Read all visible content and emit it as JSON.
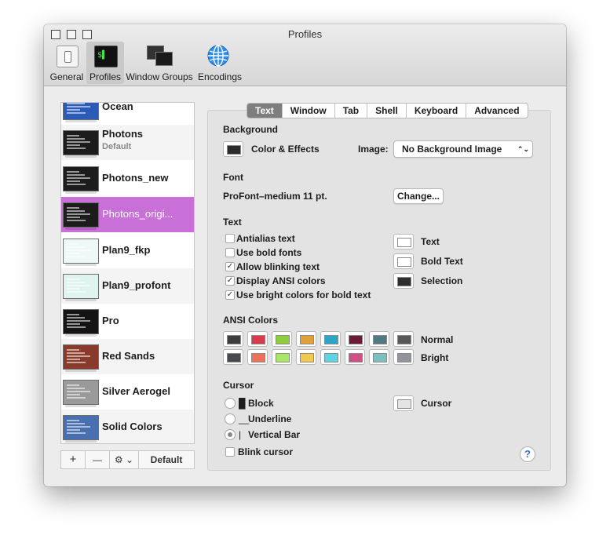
{
  "window": {
    "title": "Profiles"
  },
  "toolbar": {
    "items": [
      {
        "label": "General",
        "icon": "switch-icon"
      },
      {
        "label": "Profiles",
        "icon": "terminal-icon"
      },
      {
        "label": "Window Groups",
        "icon": "window-groups-icon"
      },
      {
        "label": "Encodings",
        "icon": "globe-icon"
      }
    ]
  },
  "profiles": {
    "items": [
      {
        "name": "Ocean",
        "subtitle": "",
        "thumb_color": "#2a5bb8"
      },
      {
        "name": "Photons",
        "subtitle": "Default",
        "thumb_color": "#1c1c1c"
      },
      {
        "name": "Photons_new",
        "subtitle": "",
        "thumb_color": "#1c1c1c"
      },
      {
        "name": "Photons_origi...",
        "subtitle": "",
        "thumb_color": "#1c1c1c"
      },
      {
        "name": "Plan9_fkp",
        "subtitle": "",
        "thumb_color": "#eef8f6"
      },
      {
        "name": "Plan9_profont",
        "subtitle": "",
        "thumb_color": "#dff4ee"
      },
      {
        "name": "Pro",
        "subtitle": "",
        "thumb_color": "#141414"
      },
      {
        "name": "Red Sands",
        "subtitle": "",
        "thumb_color": "#8a3a2a"
      },
      {
        "name": "Silver Aerogel",
        "subtitle": "",
        "thumb_color": "#9a9a9a"
      },
      {
        "name": "Solid Colors",
        "subtitle": "",
        "thumb_color": "#4a6fb0"
      }
    ],
    "selected": "Photons_origi...",
    "selected_color": "#c86fd8",
    "add_label": "+",
    "remove_label": "—",
    "gear_label": "⚙ ⌄",
    "default_label": "Default"
  },
  "tabs": [
    "Text",
    "Window",
    "Tab",
    "Shell",
    "Keyboard",
    "Advanced"
  ],
  "selected_tab": "Text",
  "background": {
    "heading": "Background",
    "color_effects_label": "Color & Effects",
    "image_label": "Image:",
    "image_value": "No Background Image",
    "swatch_color": "#2b2b2b"
  },
  "font": {
    "heading": "Font",
    "value": "ProFont–medium 11 pt.",
    "change_label": "Change..."
  },
  "text": {
    "heading": "Text",
    "options": [
      {
        "label": "Antialias text",
        "checked": false
      },
      {
        "label": "Use bold fonts",
        "checked": false
      },
      {
        "label": "Allow blinking text",
        "checked": true
      },
      {
        "label": "Display ANSI colors",
        "checked": true
      },
      {
        "label": "Use bright colors for bold text",
        "checked": true
      }
    ],
    "colors": [
      {
        "label": "Text",
        "color": "#ffffff"
      },
      {
        "label": "Bold Text",
        "color": "#ffffff"
      },
      {
        "label": "Selection",
        "color": "#2e2e2e"
      }
    ]
  },
  "ansi": {
    "heading": "ANSI Colors",
    "normal_label": "Normal",
    "bright_label": "Bright",
    "normal": [
      "#3d3d3d",
      "#d83a4e",
      "#8fcc3e",
      "#e2a138",
      "#2ba5c8",
      "#6b1a38",
      "#4f7a82",
      "#59595b"
    ],
    "bright": [
      "#454a4e",
      "#ee6f5a",
      "#a9e864",
      "#f2c94a",
      "#5fd3e3",
      "#d24f86",
      "#7cbfbf",
      "#919599"
    ]
  },
  "cursor": {
    "heading": "Cursor",
    "options": [
      {
        "glyph": "█",
        "label": "Block",
        "selected": false
      },
      {
        "glyph": "__",
        "label": "Underline",
        "selected": false
      },
      {
        "glyph": "|",
        "label": "Vertical Bar",
        "selected": true
      }
    ],
    "blink_label": "Blink cursor",
    "blink_checked": false,
    "color_label": "Cursor",
    "color": "#e4e4e4"
  },
  "help": {
    "label": "?"
  }
}
